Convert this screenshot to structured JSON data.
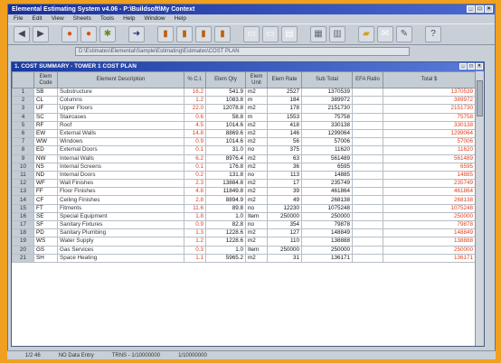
{
  "window": {
    "title": "Elemental Estimating System v4.06 - P:\\Buildsoft\\My Context"
  },
  "menu": [
    "File",
    "Edit",
    "View",
    "Sheets",
    "Tools",
    "Help",
    "Window",
    "Help"
  ],
  "address": "D:\\Estimates\\Elemental\\Sample\\Estimating\\Estimates\\COST PLAN",
  "grid": {
    "title": "1. COST SUMMARY - TOWER 1 COST PLAN",
    "headers": [
      "Elem Code",
      "Element Description",
      "% C.I.",
      "Elem Qty",
      "Elem Unit",
      "Elem Rate",
      "Sub Total",
      "EFA Ratio",
      "Total $"
    ],
    "rows": [
      {
        "n": "1",
        "code": "SB",
        "desc": "Substructure",
        "pct": "16.2",
        "qty": "541.9",
        "unit": "m2",
        "rate": "2527",
        "sub": "1370539",
        "ratio": "",
        "total": "1370539"
      },
      {
        "n": "2",
        "code": "CL",
        "desc": "Columns",
        "pct": "1.2",
        "qty": "1083.8",
        "unit": "m",
        "rate": "184",
        "sub": "389972",
        "ratio": "",
        "total": "389972"
      },
      {
        "n": "3",
        "code": "UF",
        "desc": "Upper Floors",
        "pct": "22.0",
        "qty": "12078.8",
        "unit": "m2",
        "rate": "178",
        "sub": "2151730",
        "ratio": "",
        "total": "2151730"
      },
      {
        "n": "4",
        "code": "SC",
        "desc": "Staircases",
        "pct": "0.6",
        "qty": "58.8",
        "unit": "m",
        "rate": "1553",
        "sub": "75758",
        "ratio": "",
        "total": "75758"
      },
      {
        "n": "5",
        "code": "RF",
        "desc": "Roof",
        "pct": "4.5",
        "qty": "1014.6",
        "unit": "m2",
        "rate": "418",
        "sub": "330138",
        "ratio": "",
        "total": "330138"
      },
      {
        "n": "6",
        "code": "EW",
        "desc": "External Walls",
        "pct": "14.8",
        "qty": "8869.6",
        "unit": "m2",
        "rate": "146",
        "sub": "1299064",
        "ratio": "",
        "total": "1299064"
      },
      {
        "n": "7",
        "code": "WW",
        "desc": "Windows",
        "pct": "0.9",
        "qty": "1014.6",
        "unit": "m2",
        "rate": "56",
        "sub": "57006",
        "ratio": "",
        "total": "57006"
      },
      {
        "n": "8",
        "code": "ED",
        "desc": "External Doors",
        "pct": "0.1",
        "qty": "31.0",
        "unit": "no",
        "rate": "375",
        "sub": "11620",
        "ratio": "",
        "total": "11620"
      },
      {
        "n": "9",
        "code": "NW",
        "desc": "Internal Walls",
        "pct": "6.2",
        "qty": "8976.4",
        "unit": "m2",
        "rate": "63",
        "sub": "561489",
        "ratio": "",
        "total": "561489"
      },
      {
        "n": "10",
        "code": "NS",
        "desc": "Internal Screens",
        "pct": "0.1",
        "qty": "176.8",
        "unit": "m2",
        "rate": "36",
        "sub": "6595",
        "ratio": "",
        "total": "6595"
      },
      {
        "n": "11",
        "code": "ND",
        "desc": "Internal Doors",
        "pct": "0.2",
        "qty": "131.8",
        "unit": "no",
        "rate": "113",
        "sub": "14885",
        "ratio": "",
        "total": "14885"
      },
      {
        "n": "12",
        "code": "WF",
        "desc": "Wall Finishes",
        "pct": "2.3",
        "qty": "13884.8",
        "unit": "m2",
        "rate": "17",
        "sub": "235749",
        "ratio": "",
        "total": "235749"
      },
      {
        "n": "13",
        "code": "FF",
        "desc": "Floor Finishes",
        "pct": "4.8",
        "qty": "11849.8",
        "unit": "m2",
        "rate": "39",
        "sub": "461864",
        "ratio": "",
        "total": "461864"
      },
      {
        "n": "14",
        "code": "CF",
        "desc": "Ceiling Finishes",
        "pct": "2.8",
        "qty": "8894.9",
        "unit": "m2",
        "rate": "49",
        "sub": "268138",
        "ratio": "",
        "total": "268138"
      },
      {
        "n": "15",
        "code": "FT",
        "desc": "Fitments",
        "pct": "11.6",
        "qty": "89.8",
        "unit": "no",
        "rate": "12230",
        "sub": "1075248",
        "ratio": "",
        "total": "1075248"
      },
      {
        "n": "16",
        "code": "SE",
        "desc": "Special Equipment",
        "pct": "1.8",
        "qty": "1.0",
        "unit": "Item",
        "rate": "250000",
        "sub": "250000",
        "ratio": "",
        "total": "250000"
      },
      {
        "n": "17",
        "code": "SF",
        "desc": "Sanitary Fixtures",
        "pct": "0.9",
        "qty": "82.8",
        "unit": "no",
        "rate": "354",
        "sub": "79878",
        "ratio": "",
        "total": "79878"
      },
      {
        "n": "18",
        "code": "PD",
        "desc": "Sanitary Plumbing",
        "pct": "1.3",
        "qty": "1228.6",
        "unit": "m2",
        "rate": "127",
        "sub": "148849",
        "ratio": "",
        "total": "148849"
      },
      {
        "n": "19",
        "code": "WS",
        "desc": "Water Supply",
        "pct": "1.2",
        "qty": "1228.6",
        "unit": "m2",
        "rate": "110",
        "sub": "138888",
        "ratio": "",
        "total": "138888"
      },
      {
        "n": "20",
        "code": "GS",
        "desc": "Gas Services",
        "pct": "0.3",
        "qty": "1.0",
        "unit": "Item",
        "rate": "250000",
        "sub": "250000",
        "ratio": "",
        "total": "250000"
      },
      {
        "n": "21",
        "code": "SH",
        "desc": "Space Heating",
        "pct": "1.1",
        "qty": "5965.2",
        "unit": "m2",
        "rate": "31",
        "sub": "136171",
        "ratio": "",
        "total": "136171"
      }
    ]
  },
  "status": [
    "1/2 46",
    "NO Data Entry",
    "TRNS - 1/10000000",
    "1/10000000"
  ]
}
